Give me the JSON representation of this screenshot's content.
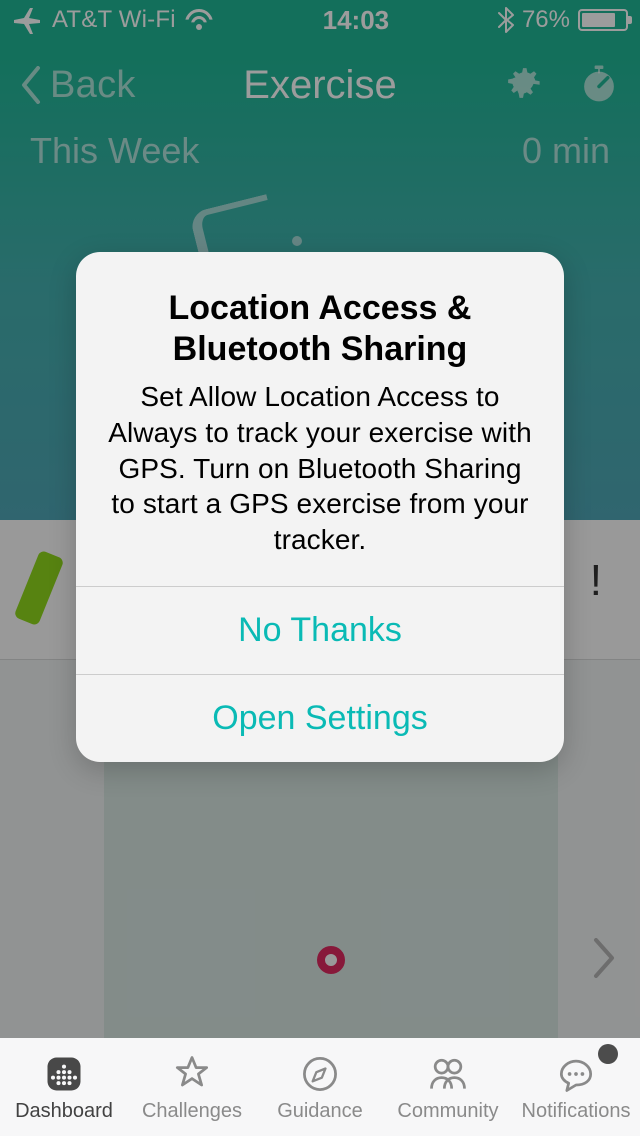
{
  "status_bar": {
    "carrier": "AT&T Wi-Fi",
    "time": "14:03",
    "battery_pct": "76%"
  },
  "navbar": {
    "back_label": "Back",
    "title": "Exercise"
  },
  "week": {
    "label": "This Week",
    "value": "0 min"
  },
  "alert": {
    "title": "Location Access & Bluetooth Sharing",
    "message": "Set Allow Location Access to Always to track your exercise with GPS.\nTurn on Bluetooth Sharing to start a GPS exercise from your tracker.",
    "buttons": [
      "No Thanks",
      "Open Settings"
    ]
  },
  "tabs": {
    "items": [
      {
        "label": "Dashboard"
      },
      {
        "label": "Challenges"
      },
      {
        "label": "Guidance"
      },
      {
        "label": "Community"
      },
      {
        "label": "Notifications"
      }
    ]
  }
}
